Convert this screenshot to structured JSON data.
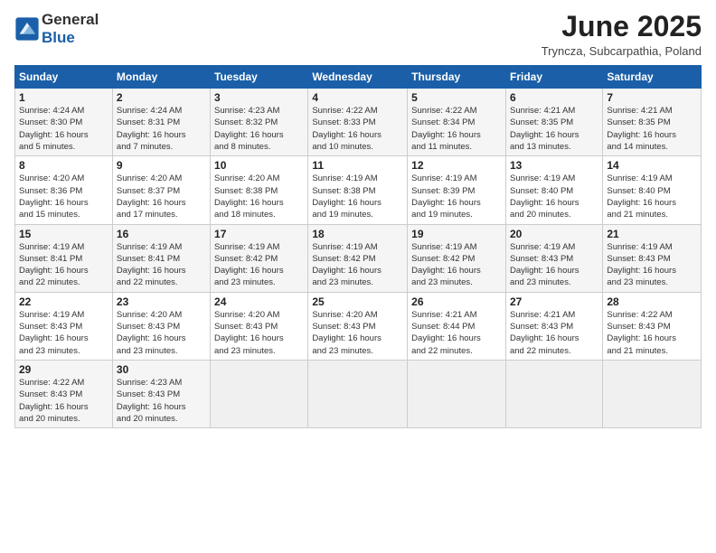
{
  "header": {
    "logo_general": "General",
    "logo_blue": "Blue",
    "month_title": "June 2025",
    "location": "Tryncza, Subcarpathia, Poland"
  },
  "days_of_week": [
    "Sunday",
    "Monday",
    "Tuesday",
    "Wednesday",
    "Thursday",
    "Friday",
    "Saturday"
  ],
  "weeks": [
    [
      {
        "day": "1",
        "sunrise": "4:24 AM",
        "sunset": "8:30 PM",
        "daylight": "16 hours and 5 minutes."
      },
      {
        "day": "2",
        "sunrise": "4:24 AM",
        "sunset": "8:31 PM",
        "daylight": "16 hours and 7 minutes."
      },
      {
        "day": "3",
        "sunrise": "4:23 AM",
        "sunset": "8:32 PM",
        "daylight": "16 hours and 8 minutes."
      },
      {
        "day": "4",
        "sunrise": "4:22 AM",
        "sunset": "8:33 PM",
        "daylight": "16 hours and 10 minutes."
      },
      {
        "day": "5",
        "sunrise": "4:22 AM",
        "sunset": "8:34 PM",
        "daylight": "16 hours and 11 minutes."
      },
      {
        "day": "6",
        "sunrise": "4:21 AM",
        "sunset": "8:35 PM",
        "daylight": "16 hours and 13 minutes."
      },
      {
        "day": "7",
        "sunrise": "4:21 AM",
        "sunset": "8:35 PM",
        "daylight": "16 hours and 14 minutes."
      }
    ],
    [
      {
        "day": "8",
        "sunrise": "4:20 AM",
        "sunset": "8:36 PM",
        "daylight": "16 hours and 15 minutes."
      },
      {
        "day": "9",
        "sunrise": "4:20 AM",
        "sunset": "8:37 PM",
        "daylight": "16 hours and 17 minutes."
      },
      {
        "day": "10",
        "sunrise": "4:20 AM",
        "sunset": "8:38 PM",
        "daylight": "16 hours and 18 minutes."
      },
      {
        "day": "11",
        "sunrise": "4:19 AM",
        "sunset": "8:38 PM",
        "daylight": "16 hours and 19 minutes."
      },
      {
        "day": "12",
        "sunrise": "4:19 AM",
        "sunset": "8:39 PM",
        "daylight": "16 hours and 19 minutes."
      },
      {
        "day": "13",
        "sunrise": "4:19 AM",
        "sunset": "8:40 PM",
        "daylight": "16 hours and 20 minutes."
      },
      {
        "day": "14",
        "sunrise": "4:19 AM",
        "sunset": "8:40 PM",
        "daylight": "16 hours and 21 minutes."
      }
    ],
    [
      {
        "day": "15",
        "sunrise": "4:19 AM",
        "sunset": "8:41 PM",
        "daylight": "16 hours and 22 minutes."
      },
      {
        "day": "16",
        "sunrise": "4:19 AM",
        "sunset": "8:41 PM",
        "daylight": "16 hours and 22 minutes."
      },
      {
        "day": "17",
        "sunrise": "4:19 AM",
        "sunset": "8:42 PM",
        "daylight": "16 hours and 23 minutes."
      },
      {
        "day": "18",
        "sunrise": "4:19 AM",
        "sunset": "8:42 PM",
        "daylight": "16 hours and 23 minutes."
      },
      {
        "day": "19",
        "sunrise": "4:19 AM",
        "sunset": "8:42 PM",
        "daylight": "16 hours and 23 minutes."
      },
      {
        "day": "20",
        "sunrise": "4:19 AM",
        "sunset": "8:43 PM",
        "daylight": "16 hours and 23 minutes."
      },
      {
        "day": "21",
        "sunrise": "4:19 AM",
        "sunset": "8:43 PM",
        "daylight": "16 hours and 23 minutes."
      }
    ],
    [
      {
        "day": "22",
        "sunrise": "4:19 AM",
        "sunset": "8:43 PM",
        "daylight": "16 hours and 23 minutes."
      },
      {
        "day": "23",
        "sunrise": "4:20 AM",
        "sunset": "8:43 PM",
        "daylight": "16 hours and 23 minutes."
      },
      {
        "day": "24",
        "sunrise": "4:20 AM",
        "sunset": "8:43 PM",
        "daylight": "16 hours and 23 minutes."
      },
      {
        "day": "25",
        "sunrise": "4:20 AM",
        "sunset": "8:43 PM",
        "daylight": "16 hours and 23 minutes."
      },
      {
        "day": "26",
        "sunrise": "4:21 AM",
        "sunset": "8:44 PM",
        "daylight": "16 hours and 22 minutes."
      },
      {
        "day": "27",
        "sunrise": "4:21 AM",
        "sunset": "8:43 PM",
        "daylight": "16 hours and 22 minutes."
      },
      {
        "day": "28",
        "sunrise": "4:22 AM",
        "sunset": "8:43 PM",
        "daylight": "16 hours and 21 minutes."
      }
    ],
    [
      {
        "day": "29",
        "sunrise": "4:22 AM",
        "sunset": "8:43 PM",
        "daylight": "16 hours and 20 minutes."
      },
      {
        "day": "30",
        "sunrise": "4:23 AM",
        "sunset": "8:43 PM",
        "daylight": "16 hours and 20 minutes."
      },
      null,
      null,
      null,
      null,
      null
    ]
  ],
  "labels": {
    "sunrise": "Sunrise:",
    "sunset": "Sunset:",
    "daylight": "Daylight:"
  }
}
